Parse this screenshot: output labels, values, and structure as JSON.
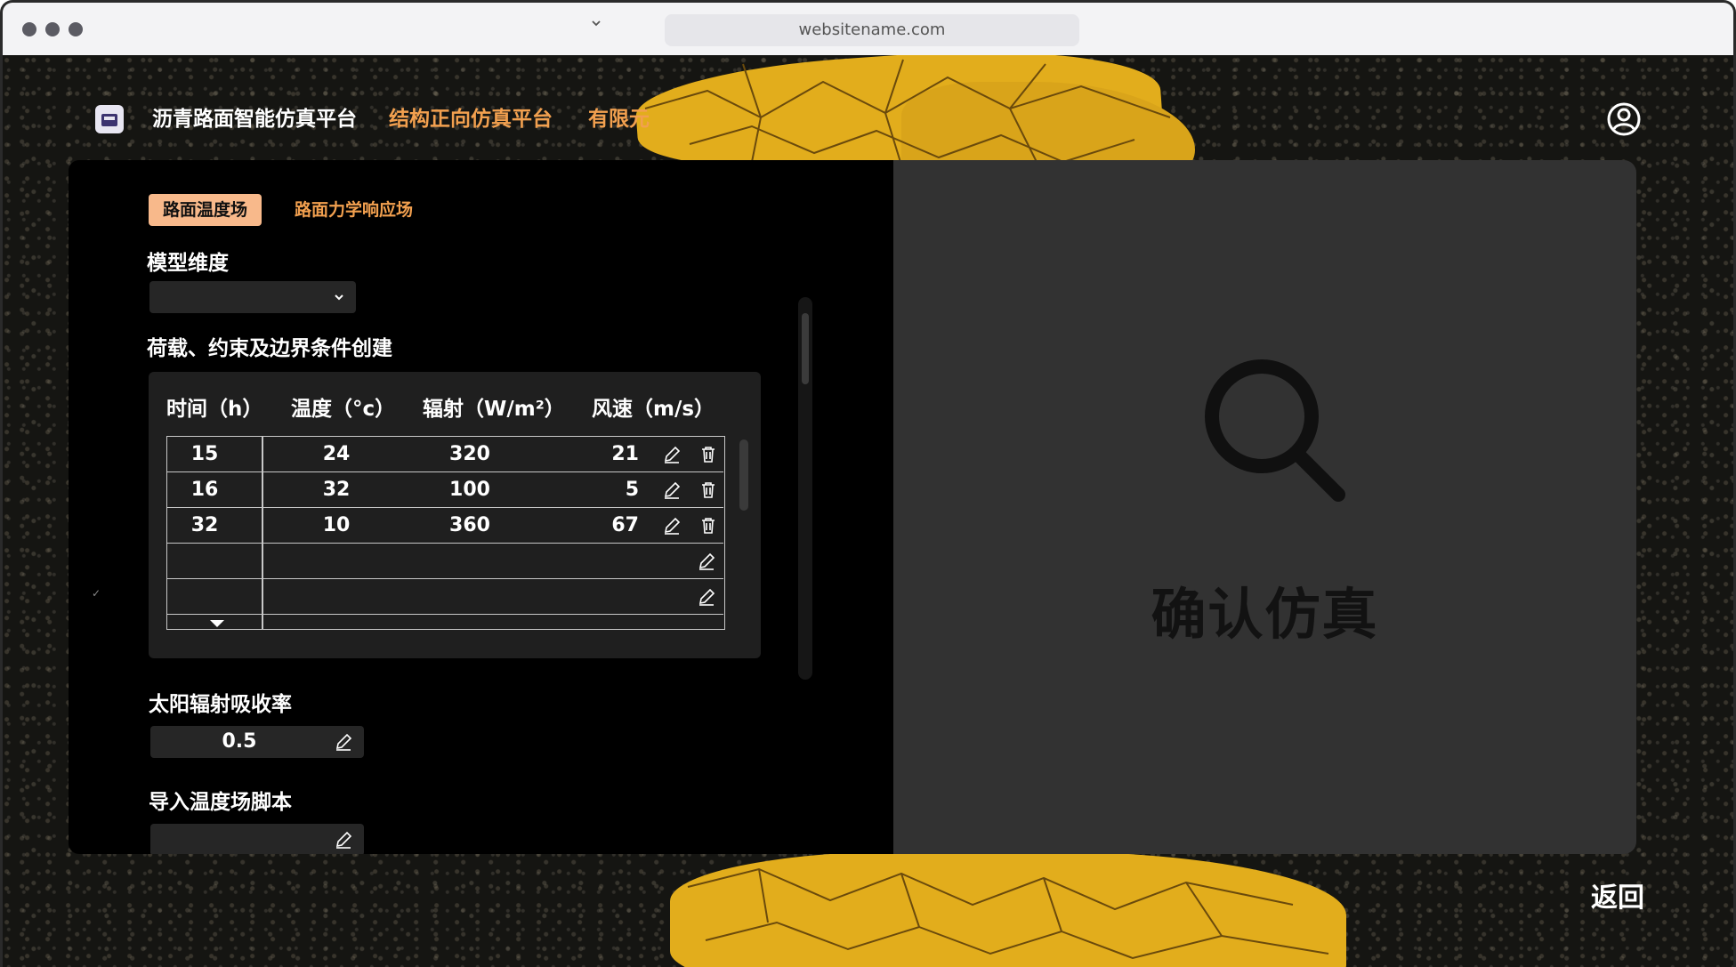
{
  "browser": {
    "url": "websitename.com"
  },
  "nav": {
    "brand": "沥青路面智能仿真平台",
    "items": [
      "结构正向仿真平台",
      "有限元"
    ]
  },
  "tabs": [
    {
      "label": "路面温度场",
      "active": true
    },
    {
      "label": "路面力学响应场",
      "active": false
    }
  ],
  "form": {
    "model_dimension_label": "模型维度",
    "model_dimension_value": "",
    "conditions_label": "荷载、约束及边界条件创建",
    "table": {
      "headers": [
        "时间（h）",
        "温度（°c）",
        "辐射（W/m²）",
        "风速（m/s）"
      ],
      "rows": [
        {
          "time": "15",
          "temp": "24",
          "rad": "320",
          "wind": "21"
        },
        {
          "time": "16",
          "temp": "32",
          "rad": "100",
          "wind": "5"
        },
        {
          "time": "32",
          "temp": "10",
          "rad": "360",
          "wind": "67"
        },
        {
          "time": "",
          "temp": "",
          "rad": "",
          "wind": ""
        },
        {
          "time": "",
          "temp": "",
          "rad": "",
          "wind": ""
        }
      ]
    },
    "absorption_label": "太阳辐射吸收率",
    "absorption_value": "0.5",
    "script_label": "导入温度场脚本",
    "script_value": ""
  },
  "preview": {
    "confirm_label": "确认仿真",
    "icon": "search-icon"
  },
  "footer": {
    "back_label": "返回"
  },
  "colors": {
    "accent": "#f2a04f",
    "tab_active_bg": "#f8b98b",
    "panel_right": "#323232"
  }
}
